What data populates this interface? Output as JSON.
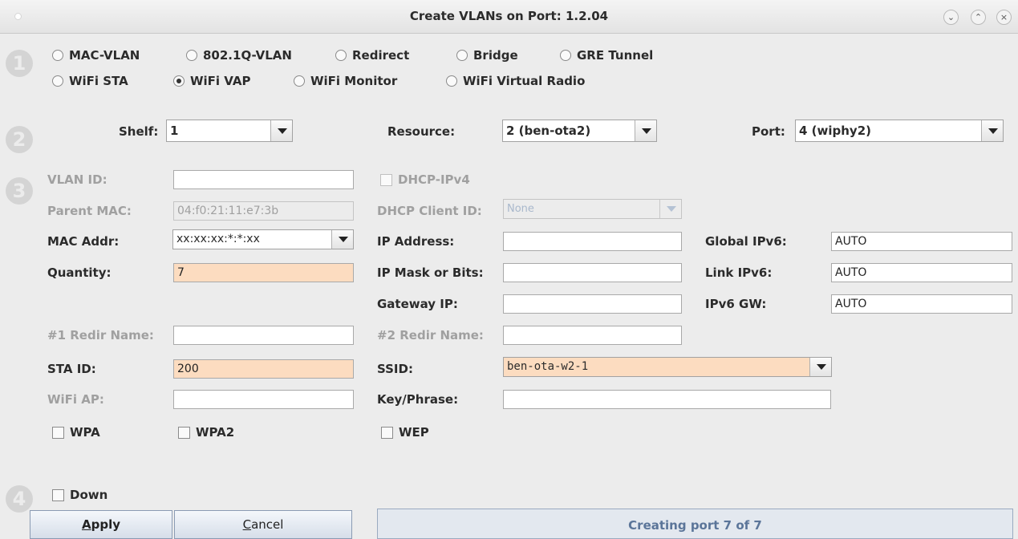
{
  "window": {
    "title": "Create VLANs on Port: 1.2.04",
    "controls": [
      "minimize",
      "maximize",
      "close"
    ]
  },
  "steps": [
    "1",
    "2",
    "3",
    "4"
  ],
  "port_types": [
    {
      "label": "MAC-VLAN",
      "selected": false
    },
    {
      "label": "802.1Q-VLAN",
      "selected": false
    },
    {
      "label": "Redirect",
      "selected": false
    },
    {
      "label": "Bridge",
      "selected": false
    },
    {
      "label": "GRE Tunnel",
      "selected": false
    },
    {
      "label": "WiFi STA",
      "selected": false
    },
    {
      "label": "WiFi VAP",
      "selected": true
    },
    {
      "label": "WiFi Monitor",
      "selected": false
    },
    {
      "label": "WiFi Virtual Radio",
      "selected": false
    }
  ],
  "location": {
    "shelf_label": "Shelf:",
    "shelf_value": "1",
    "resource_label": "Resource:",
    "resource_value": "2 (ben-ota2)",
    "port_label": "Port:",
    "port_value": "4 (wiphy2)"
  },
  "form": {
    "vlan_id_label": "VLAN ID:",
    "vlan_id_value": "",
    "dhcp_ipv4_label": "DHCP-IPv4",
    "parent_mac_label": "Parent MAC:",
    "parent_mac_value": "04:f0:21:11:e7:3b",
    "dhcp_client_id_label": "DHCP Client ID:",
    "dhcp_client_id_value": "None",
    "mac_addr_label": "MAC Addr:",
    "mac_addr_value": "xx:xx:xx:*:*:xx",
    "ip_address_label": "IP Address:",
    "ip_address_value": "",
    "global_ipv6_label": "Global IPv6:",
    "global_ipv6_value": "AUTO",
    "quantity_label": "Quantity:",
    "quantity_value": "7",
    "ip_mask_label": "IP Mask or Bits:",
    "ip_mask_value": "",
    "link_ipv6_label": "Link IPv6:",
    "link_ipv6_value": "AUTO",
    "gateway_ip_label": "Gateway IP:",
    "gateway_ip_value": "",
    "ipv6_gw_label": "IPv6 GW:",
    "ipv6_gw_value": "AUTO",
    "redir1_label": "#1 Redir Name:",
    "redir1_value": "",
    "redir2_label": "#2 Redir Name:",
    "redir2_value": "",
    "sta_id_label": "STA ID:",
    "sta_id_value": "200",
    "ssid_label": "SSID:",
    "ssid_value": "ben-ota-w2-1",
    "wifi_ap_label": "WiFi AP:",
    "wifi_ap_value": "",
    "key_phrase_label": "Key/Phrase:",
    "key_phrase_value": "",
    "wpa_label": "WPA",
    "wpa2_label": "WPA2",
    "wep_label": "WEP"
  },
  "footer": {
    "down_label": "Down",
    "apply_mnemonic": "A",
    "apply_rest": "pply",
    "cancel_mnemonic": "C",
    "cancel_rest": "ancel",
    "status": "Creating port 7 of 7"
  }
}
